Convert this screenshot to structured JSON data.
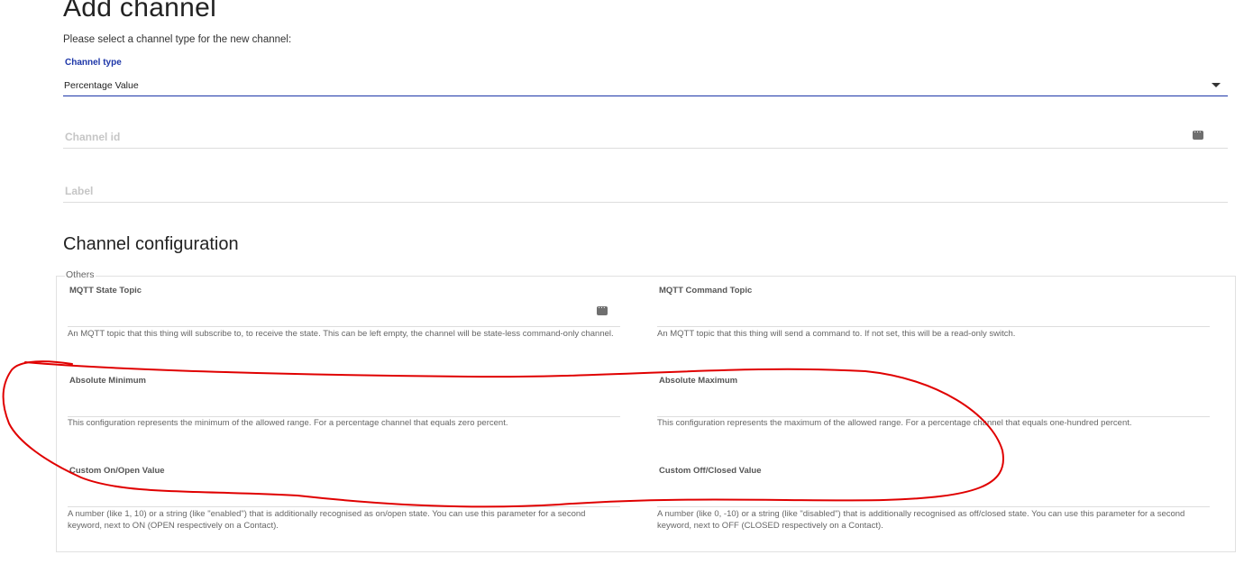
{
  "page": {
    "title": "Add channel",
    "subtitle": "Please select a channel type for the new channel:"
  },
  "channel_type": {
    "label": "Channel type",
    "value": "Percentage Value"
  },
  "channel_id": {
    "placeholder": "Channel id"
  },
  "label_field": {
    "placeholder": "Label"
  },
  "config": {
    "title": "Channel configuration",
    "group": "Others",
    "params": [
      {
        "label": "MQTT State Topic",
        "description": "An MQTT topic that this thing will subscribe to, to receive the state. This can be left empty, the channel will be state-less command-only channel."
      },
      {
        "label": "MQTT Command Topic",
        "description": "An MQTT topic that this thing will send a command to. If not set, this will be a read-only switch."
      },
      {
        "label": "Absolute Minimum",
        "description": "This configuration represents the minimum of the allowed range. For a percentage channel that equals zero percent."
      },
      {
        "label": "Absolute Maximum",
        "description": "This configuration represents the maximum of the allowed range. For a percentage channel that equals one-hundred percent."
      },
      {
        "label": "Custom On/Open Value",
        "description": "A number (like 1, 10) or a string (like \"enabled\") that is additionally recognised as on/open state. You can use this parameter for a second keyword, next to ON (OPEN respectively on a Contact)."
      },
      {
        "label": "Custom Off/Closed Value",
        "description": "A number (like 0, -10) or a string (like \"disabled\") that is additionally recognised as off/closed state. You can use this parameter for a second keyword, next to OFF (CLOSED respectively on a Contact)."
      }
    ]
  },
  "icons": {
    "dropdown": "caret-down-icon",
    "keyboard": "keyboard-icon"
  },
  "colors": {
    "accent": "#1d36a8",
    "annotation": "#e00000"
  }
}
